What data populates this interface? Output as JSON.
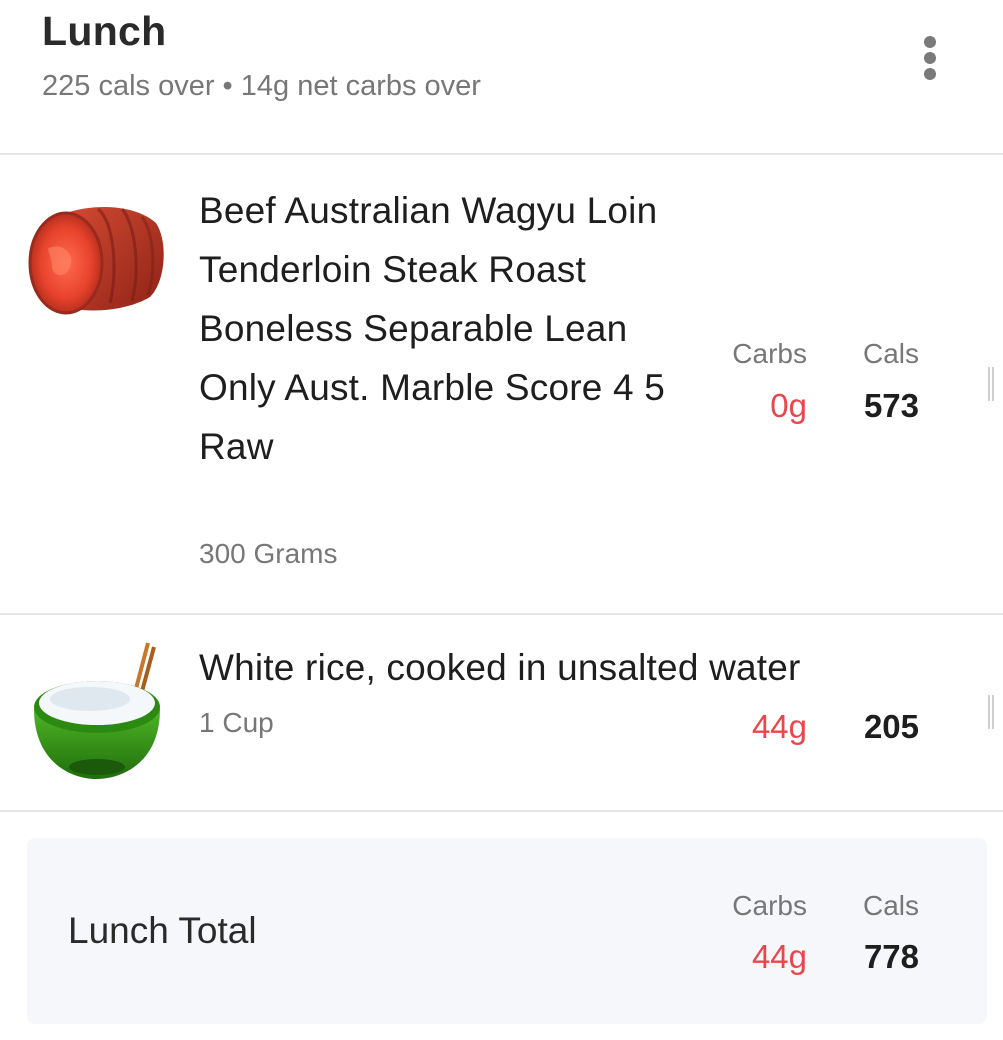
{
  "meal": {
    "title": "Lunch",
    "summary": "225 cals over • 14g net carbs over"
  },
  "columns": {
    "carbs_label": "Carbs",
    "cals_label": "Cals"
  },
  "items": [
    {
      "name": "Beef Australian Wagyu Loin Tenderloin Steak Roast Boneless Separable Lean Only Aust. Marble Score 4 5 Raw",
      "serving": "300 Grams",
      "carbs": "0g",
      "cals": "573",
      "icon": "beef-steak-icon"
    },
    {
      "name": "White rice, cooked in unsalted water",
      "serving": "1 Cup",
      "carbs": "44g",
      "cals": "205",
      "icon": "rice-bowl-icon"
    }
  ],
  "total": {
    "label": "Lunch Total",
    "carbs": "44g",
    "cals": "778"
  },
  "colors": {
    "carbs_accent": "#e8474b",
    "total_background": "#f5f7fb",
    "divider": "#e6e6e6"
  }
}
